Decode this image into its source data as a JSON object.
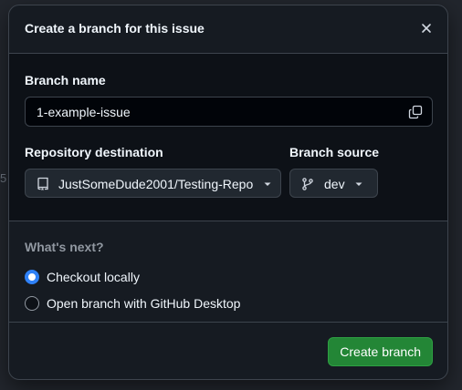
{
  "dialog": {
    "title": "Create a branch for this issue",
    "close_icon": "x-icon"
  },
  "branch_name": {
    "label": "Branch name",
    "value": "1-example-issue",
    "copy_icon": "copy-icon"
  },
  "repository": {
    "label": "Repository destination",
    "value": "JustSomeDude2001/Testing-Repo",
    "icon": "repo-icon"
  },
  "branch_source": {
    "label": "Branch source",
    "value": "dev",
    "icon": "git-branch-icon"
  },
  "whats_next": {
    "label": "What's next?",
    "options": [
      {
        "label": "Checkout locally",
        "checked": true
      },
      {
        "label": "Open branch with GitHub Desktop",
        "checked": false
      }
    ]
  },
  "footer": {
    "create_label": "Create branch"
  },
  "colors": {
    "accent_blue": "#2f81f7",
    "primary_green": "#238636",
    "dialog_bg": "#161b22",
    "border": "#3d444d"
  }
}
